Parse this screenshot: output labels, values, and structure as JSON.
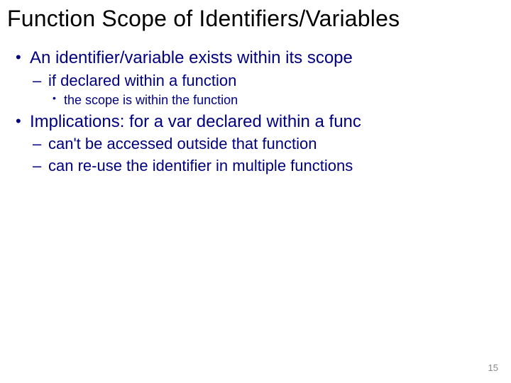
{
  "title": "Function Scope of Identifiers/Variables",
  "bullets": {
    "b1": "An identifier/variable exists within its scope",
    "b1_1": "if declared within a function",
    "b1_1_1": "the scope is within the function",
    "b2": "Implications: for a var declared within a func",
    "b2_1": "can't be accessed outside that function",
    "b2_2": "can re-use the identifier in multiple functions"
  },
  "page_number": "15"
}
